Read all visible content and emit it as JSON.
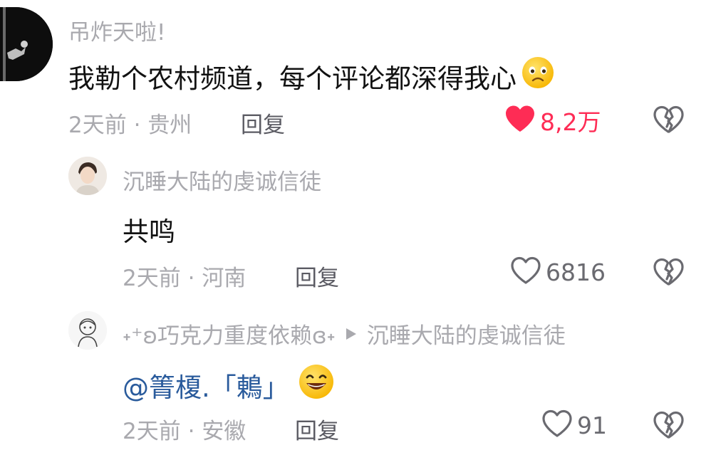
{
  "comments": [
    {
      "username": "吊炸天啦!",
      "text": "我勒个农村频道，每个评论都深得我心",
      "emoji": "worried-face",
      "time": "2天前",
      "location": "贵州",
      "reply_label": "回复",
      "likes": "8,2万",
      "liked": true
    }
  ],
  "replies": [
    {
      "username": "沉睡大陆的虔诚信徒",
      "text": "共鸣",
      "time": "2天前",
      "location": "河南",
      "reply_label": "回复",
      "likes": "6816"
    },
    {
      "username": "˖⁺ʚ巧克力重度依赖ɞ˖",
      "reply_to": "沉睡大陆的虔诚信徒",
      "mention": "@箐榎.「鶇」",
      "emoji": "grinning-face",
      "time": "2天前",
      "location": "安徽",
      "reply_label": "回复",
      "likes": "91"
    }
  ],
  "separator": "·",
  "colors": {
    "like_red": "#fe2c55",
    "meta_gray": "#a9a9ae",
    "mention_blue": "#2a5b9c"
  }
}
